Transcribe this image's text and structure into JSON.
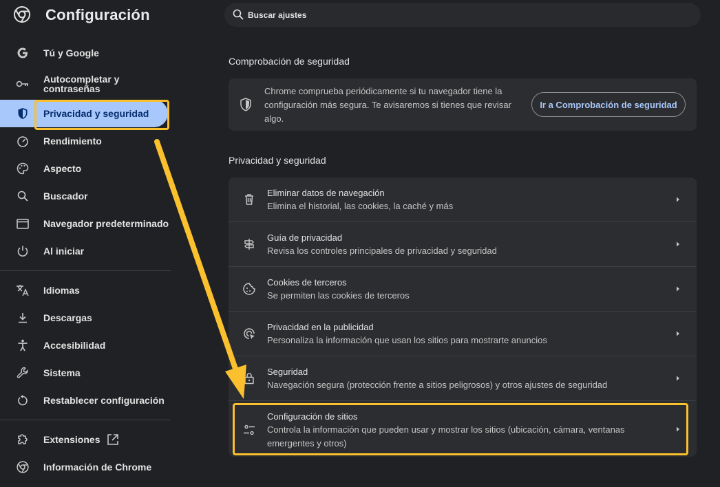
{
  "app": {
    "title": "Configuración",
    "logo_icon": "chrome-icon"
  },
  "search": {
    "placeholder": "Buscar ajustes",
    "icon": "search-icon"
  },
  "sidebar": {
    "items": [
      {
        "label": "Tú y Google",
        "icon": "google-icon"
      },
      {
        "label": "Autocompletar y contraseñas",
        "icon": "key-icon"
      },
      {
        "label": "Privacidad y seguridad",
        "icon": "shield-icon",
        "active": true
      },
      {
        "label": "Rendimiento",
        "icon": "speedometer-icon"
      },
      {
        "label": "Aspecto",
        "icon": "palette-icon"
      },
      {
        "label": "Buscador",
        "icon": "search-icon"
      },
      {
        "label": "Navegador predeterminado",
        "icon": "browser-icon"
      },
      {
        "label": "Al iniciar",
        "icon": "power-icon"
      },
      {
        "label": "Idiomas",
        "icon": "translate-icon"
      },
      {
        "label": "Descargas",
        "icon": "download-icon"
      },
      {
        "label": "Accesibilidad",
        "icon": "accessibility-icon"
      },
      {
        "label": "Sistema",
        "icon": "wrench-icon"
      },
      {
        "label": "Restablecer configuración",
        "icon": "reset-icon"
      },
      {
        "label": "Extensiones",
        "icon": "puzzle-icon"
      },
      {
        "label": "Información de Chrome",
        "icon": "chrome-icon"
      }
    ],
    "autocomplete_line1": "Autocompletar y",
    "autocomplete_line2": "contraseñas"
  },
  "safety_check": {
    "heading": "Comprobación de seguridad",
    "description": "Chrome comprueba periódicamente si tu navegador tiene la configuración más segura. Te avisaremos si tienes que revisar algo.",
    "button_label": "Ir a Comprobación de seguridad"
  },
  "privacy": {
    "heading": "Privacidad y seguridad",
    "rows": [
      {
        "title": "Eliminar datos de navegación",
        "subtitle": "Elimina el historial, las cookies, la caché y más",
        "icon": "trash-icon"
      },
      {
        "title": "Guía de privacidad",
        "subtitle": "Revisa los controles principales de privacidad y seguridad",
        "icon": "signpost-icon"
      },
      {
        "title": "Cookies de terceros",
        "subtitle": "Se permiten las cookies de terceros",
        "icon": "cookie-icon"
      },
      {
        "title": "Privacidad en la publicidad",
        "subtitle": "Personaliza la información que usan los sitios para mostrarte anuncios",
        "icon": "ad-privacy-icon"
      },
      {
        "title": "Seguridad",
        "subtitle": "Navegación segura (protección frente a sitios peligrosos) y otros ajustes de seguridad",
        "icon": "lock-icon"
      },
      {
        "title": "Configuración de sitios",
        "subtitle": "Controla la información que pueden usar y mostrar los sitios (ubicación, cámara, ventanas emergentes y otros)",
        "icon": "tune-icon"
      }
    ]
  },
  "colors": {
    "accent": "#a8c7fa",
    "highlight": "#fbc02d",
    "background": "#202124",
    "card": "#2c2d30"
  }
}
